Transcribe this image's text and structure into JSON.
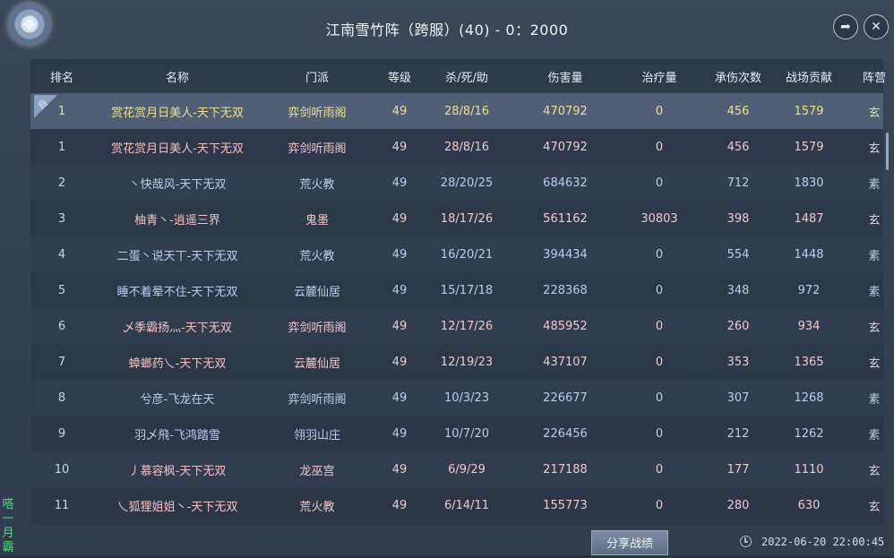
{
  "window": {
    "title": "江南雪竹阵（跨服）(40) - 0：2000",
    "share_icon": "share-arrow-icon",
    "close_icon": "close-x-icon"
  },
  "columns": [
    "排名",
    "名称",
    "门派",
    "等级",
    "杀/死/助",
    "伤害量",
    "治疗量",
    "承伤次数",
    "战场贡献",
    "阵营"
  ],
  "self_marker": "自",
  "rows": [
    {
      "rank": "1",
      "name": "赏花赏月日美人-天下无双",
      "sect": "弈剑听雨阁",
      "level": "49",
      "kda": "28/8/16",
      "damage": "470792",
      "heal": "0",
      "hits": "456",
      "contribution": "1579",
      "camp": "玄"
    },
    {
      "rank": "1",
      "name": "赏花赏月日美人-天下无双",
      "sect": "弈剑听雨阁",
      "level": "49",
      "kda": "28/8/16",
      "damage": "470792",
      "heal": "0",
      "hits": "456",
      "contribution": "1579",
      "camp": "玄"
    },
    {
      "rank": "2",
      "name": "丶快哉风-天下无双",
      "sect": "荒火教",
      "level": "49",
      "kda": "28/20/25",
      "damage": "684632",
      "heal": "0",
      "hits": "712",
      "contribution": "1830",
      "camp": "素"
    },
    {
      "rank": "3",
      "name": "柚青丶-逍遥三界",
      "sect": "鬼墨",
      "level": "49",
      "kda": "18/17/26",
      "damage": "561162",
      "heal": "30803",
      "hits": "398",
      "contribution": "1487",
      "camp": "玄"
    },
    {
      "rank": "4",
      "name": "二蛋丶说天丅-天下无双",
      "sect": "荒火教",
      "level": "49",
      "kda": "16/20/21",
      "damage": "394434",
      "heal": "0",
      "hits": "554",
      "contribution": "1448",
      "camp": "素"
    },
    {
      "rank": "5",
      "name": "睡不着晕不住-天下无双",
      "sect": "云麓仙居",
      "level": "49",
      "kda": "15/17/18",
      "damage": "228368",
      "heal": "0",
      "hits": "348",
      "contribution": "972",
      "camp": "素"
    },
    {
      "rank": "6",
      "name": "乄季霸扬灬-天下无双",
      "sect": "弈剑听雨阁",
      "level": "49",
      "kda": "12/17/26",
      "damage": "485952",
      "heal": "0",
      "hits": "260",
      "contribution": "934",
      "camp": "玄"
    },
    {
      "rank": "7",
      "name": "蟑螂药乀-天下无双",
      "sect": "云麓仙居",
      "level": "49",
      "kda": "12/19/23",
      "damage": "437107",
      "heal": "0",
      "hits": "353",
      "contribution": "1365",
      "camp": "玄"
    },
    {
      "rank": "8",
      "name": "兮彦-飞龙在天",
      "sect": "弈剑听雨阁",
      "level": "49",
      "kda": "10/3/23",
      "damage": "226677",
      "heal": "0",
      "hits": "307",
      "contribution": "1268",
      "camp": "素"
    },
    {
      "rank": "9",
      "name": "羽乄飛-飞鸿踏雪",
      "sect": "翎羽山庄",
      "level": "49",
      "kda": "10/7/20",
      "damage": "226456",
      "heal": "0",
      "hits": "212",
      "contribution": "1262",
      "camp": "素"
    },
    {
      "rank": "10",
      "name": "丿慕容枫-天下无双",
      "sect": "龙巫宫",
      "level": "49",
      "kda": "6/9/29",
      "damage": "217188",
      "heal": "0",
      "hits": "177",
      "contribution": "1110",
      "camp": "玄"
    },
    {
      "rank": "11",
      "name": "乀狐狸姐姐丶-天下无双",
      "sect": "荒火教",
      "level": "49",
      "kda": "6/14/11",
      "damage": "155773",
      "heal": "0",
      "hits": "280",
      "contribution": "630",
      "camp": "玄"
    }
  ],
  "footer": {
    "share_label": "分享战绩",
    "timestamp": "2022-06-20 22:00:45"
  },
  "side_chat": [
    "嗒",
    "一",
    "月",
    "霸"
  ]
}
